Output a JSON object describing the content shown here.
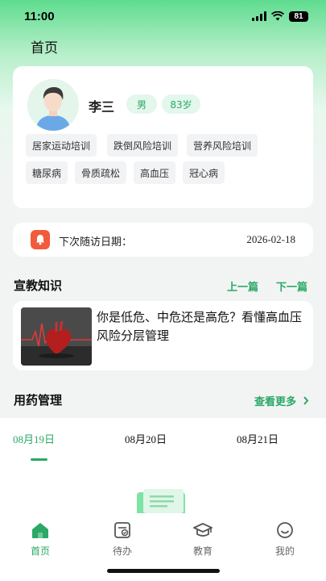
{
  "status_bar": {
    "time": "11:00",
    "battery": "81"
  },
  "page": {
    "title": "首页"
  },
  "profile": {
    "name": "李三",
    "gender": "男",
    "age": "83岁",
    "tags": [
      "居家运动培训",
      "跌倒风险培训",
      "营养风险培训",
      "糖尿病",
      "骨质疏松",
      "高血压",
      "冠心病"
    ]
  },
  "visit": {
    "label": "下次随访日期：",
    "date": "2026-02-18"
  },
  "education": {
    "title": "宣教知识",
    "prev_label": "上一篇",
    "next_label": "下一篇",
    "article_title": "你是低危、中危还是高危？看懂高血压风险分层管理"
  },
  "medication": {
    "title": "用药管理",
    "more_label": "查看更多",
    "dates": [
      "08月19日",
      "08月20日",
      "08月21日"
    ],
    "active_index": 0
  },
  "nav": {
    "items": [
      {
        "label": "首页",
        "icon": "home-icon"
      },
      {
        "label": "待办",
        "icon": "todo-icon"
      },
      {
        "label": "教育",
        "icon": "graduation-cap-icon"
      },
      {
        "label": "我的",
        "icon": "profile-smile-icon"
      }
    ],
    "active_index": 0
  },
  "colors": {
    "accent": "#2aa866",
    "bell": "#f15b3b"
  }
}
